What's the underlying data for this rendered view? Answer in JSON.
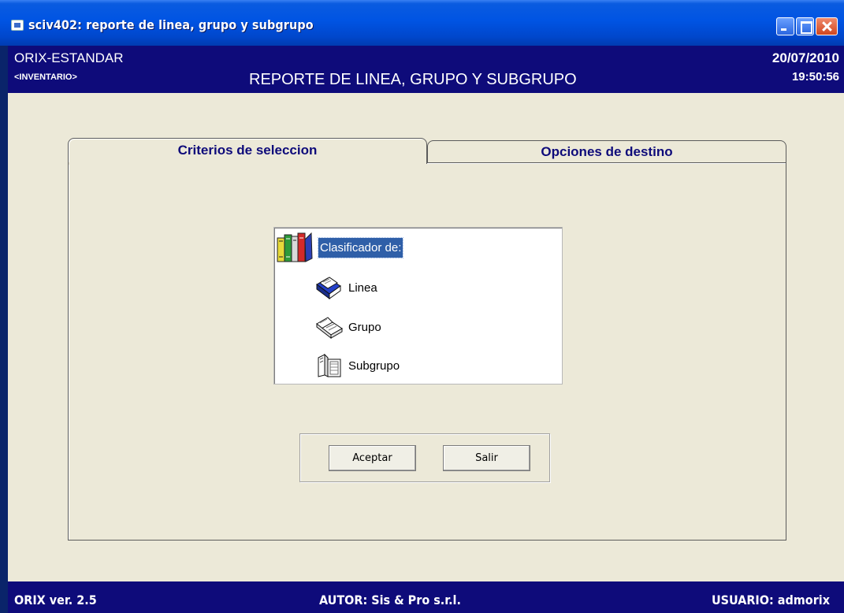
{
  "window": {
    "title": "sciv402: reporte de linea, grupo y subgrupo"
  },
  "header": {
    "system": "ORIX-ESTANDAR",
    "module": "<INVENTARIO>",
    "title": "REPORTE DE LINEA, GRUPO Y SUBGRUPO",
    "date": "20/07/2010",
    "time": "19:50:56"
  },
  "tabs": [
    {
      "label": "Criterios de seleccion",
      "selected": true
    },
    {
      "label": "Opciones de destino",
      "selected": false
    }
  ],
  "tree": {
    "root": {
      "label": "Clasificador de:",
      "icon": "books-icon",
      "selected": true
    },
    "items": [
      {
        "label": "Linea",
        "icon": "book-blue-icon"
      },
      {
        "label": "Grupo",
        "icon": "book-open-icon"
      },
      {
        "label": "Subgrupo",
        "icon": "book-stand-icon"
      }
    ]
  },
  "buttons": {
    "accept": "Aceptar",
    "exit": "Salir"
  },
  "statusbar": {
    "version": "ORIX ver. 2.5",
    "author": "AUTOR: Sis & Pro s.r.l.",
    "user": "USUARIO: admorix"
  },
  "colors": {
    "titlebar": "#0054e3",
    "header_band": "#0e0b7a",
    "client_bg": "#ece9d8",
    "selection": "#2f5fa8"
  }
}
